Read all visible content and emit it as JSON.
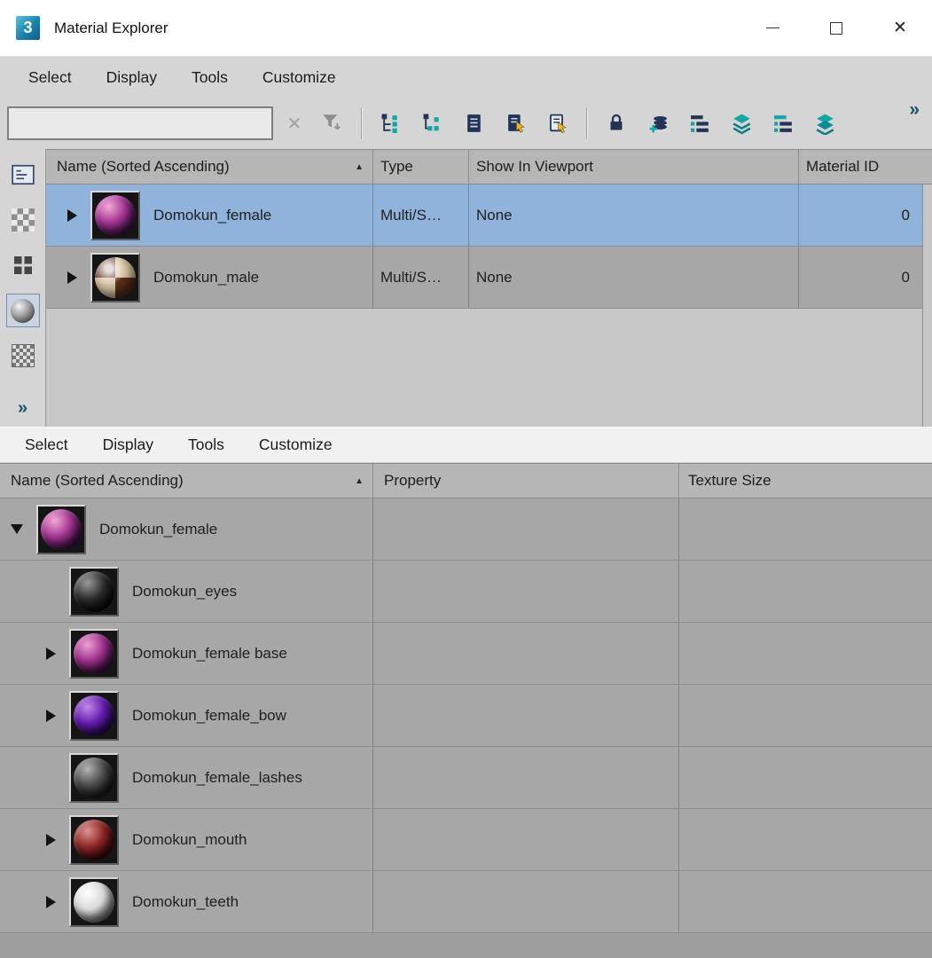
{
  "window": {
    "title": "Material Explorer",
    "app_icon_text": "3",
    "controls": {
      "close_glyph": "✕"
    }
  },
  "menus": {
    "top": [
      "Select",
      "Display",
      "Tools",
      "Customize"
    ],
    "lower": [
      "Select",
      "Display",
      "Tools",
      "Customize"
    ]
  },
  "toolbar": {
    "search": {
      "value": "",
      "placeholder": ""
    },
    "clear_glyph": "✕",
    "overflow_glyph": "»",
    "icons": [
      "clear-search-icon",
      "filter-icon",
      "expand-tree-icon",
      "collapse-tree-icon",
      "document-lines-icon",
      "document-pick-icon",
      "document-outline-pick-icon",
      "lock-icon",
      "add-coins-icon",
      "hierarchy-list-icon",
      "layers-icon",
      "hierarchy-list-teal-icon",
      "layers-teal-icon",
      "overflow-chevron-icon"
    ]
  },
  "side_toolbar": {
    "icons": [
      "list-view-icon",
      "checker-view-icon",
      "tile-view-icon",
      "material-sphere-view-icon",
      "map-checker-view-icon"
    ],
    "active_icon": "material-sphere-view-icon",
    "overflow_glyph": "»"
  },
  "upper_table": {
    "sort_indicator": "▲",
    "columns": [
      {
        "label": "Name (Sorted Ascending)",
        "sorted": true
      },
      {
        "label": "Type"
      },
      {
        "label": "Show In Viewport"
      },
      {
        "label": "Material ID"
      }
    ],
    "rows": [
      {
        "name": "Domokun_female",
        "type": "Multi/S…",
        "show_in_viewport": "None",
        "material_id": "0",
        "selected": true,
        "expandable": true,
        "sphere": {
          "hi": "#f2a8d8",
          "mid": "#a23390",
          "dark": "#330f3e",
          "style": "noise"
        }
      },
      {
        "name": "Domokun_male",
        "type": "Multi/S…",
        "show_in_viewport": "None",
        "material_id": "0",
        "selected": false,
        "expandable": true,
        "sphere": {
          "hi": "#ffffff",
          "mid": "#d8c3a2",
          "dark": "#5c2e1b",
          "style": "checker"
        }
      }
    ]
  },
  "lower_table": {
    "sort_indicator": "▲",
    "columns": [
      {
        "label": "Name (Sorted Ascending)",
        "sorted": true
      },
      {
        "label": "Property"
      },
      {
        "label": "Texture Size"
      }
    ],
    "rows": [
      {
        "name": "Domokun_female",
        "level": 0,
        "state": "expanded",
        "property": "",
        "texture_size": "",
        "sphere": {
          "hi": "#f2a8d8",
          "mid": "#a23390",
          "dark": "#330f3e"
        }
      },
      {
        "name": "Domokun_eyes",
        "level": 1,
        "state": "leaf",
        "property": "",
        "texture_size": "",
        "sphere": {
          "hi": "#9b9b9b",
          "mid": "#2d2d2d",
          "dark": "#030303"
        }
      },
      {
        "name": "Domokun_female base",
        "level": 1,
        "state": "collapsed",
        "property": "",
        "texture_size": "",
        "sphere": {
          "hi": "#ef9ed4",
          "mid": "#9c2f8a",
          "dark": "#2e0d38"
        }
      },
      {
        "name": "Domokun_female_bow",
        "level": 1,
        "state": "collapsed",
        "property": "",
        "texture_size": "",
        "sphere": {
          "hi": "#c18ae9",
          "mid": "#641cae",
          "dark": "#1d0841"
        }
      },
      {
        "name": "Domokun_female_lashes",
        "level": 1,
        "state": "leaf",
        "property": "",
        "texture_size": "",
        "sphere": {
          "hi": "#b5b5b5",
          "mid": "#4a4a4a",
          "dark": "#121212"
        }
      },
      {
        "name": "Domokun_mouth",
        "level": 1,
        "state": "collapsed",
        "property": "",
        "texture_size": "",
        "sphere": {
          "hi": "#dc9191",
          "mid": "#8c2424",
          "dark": "#2a0606"
        }
      },
      {
        "name": "Domokun_teeth",
        "level": 1,
        "state": "collapsed",
        "property": "",
        "texture_size": "",
        "sphere": {
          "hi": "#ffffff",
          "mid": "#d9d9d9",
          "dark": "#666666"
        }
      }
    ]
  },
  "colors": {
    "selection": "#8fb3da",
    "row_bg": "#a7a7a7",
    "header_bg": "#b6b6b6",
    "panel_bg": "#d5d5d5",
    "empty_bg": "#c7c7c7",
    "accent_navy": "#223455",
    "accent_teal": "#12a7a5",
    "accent_yellow": "#e9b821"
  }
}
